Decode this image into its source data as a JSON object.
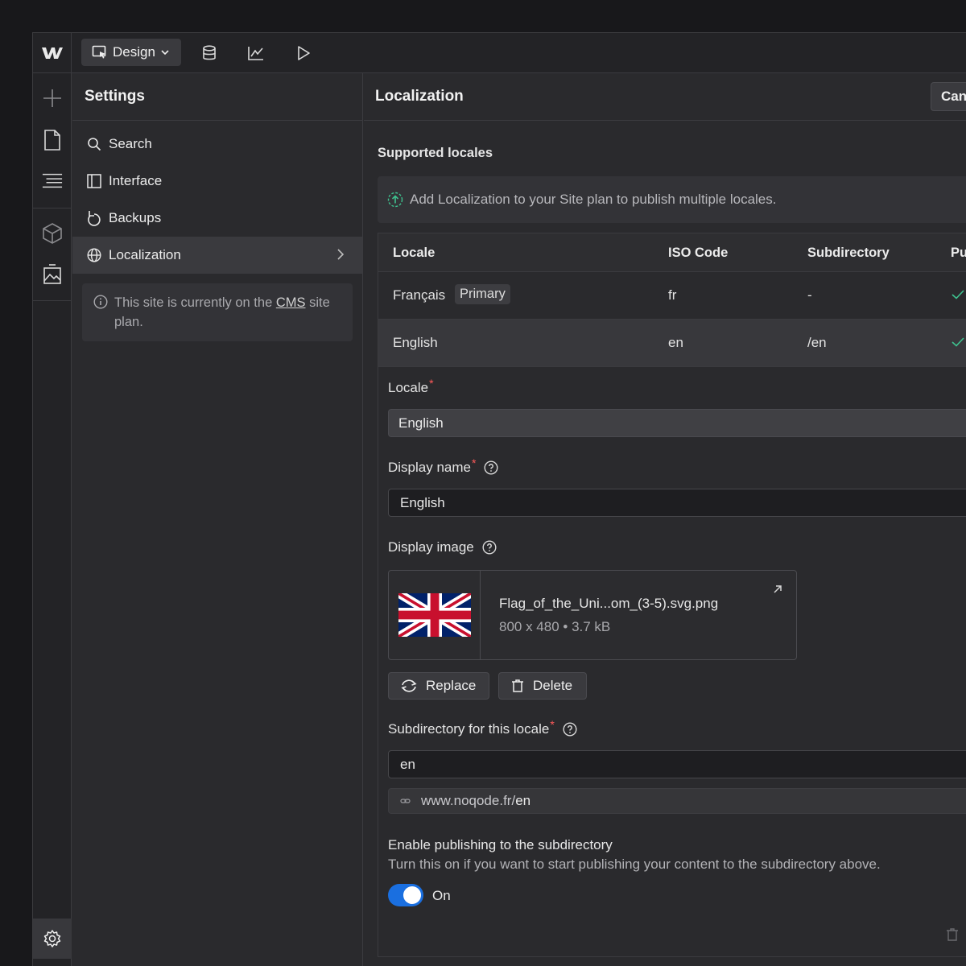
{
  "topbar": {
    "mode_label": "Design",
    "icons": [
      "webflow-logo-icon",
      "design-icon",
      "chevron-down-icon",
      "database-icon",
      "analytics-icon",
      "play-icon"
    ]
  },
  "rail": {
    "icons": [
      "add-icon",
      "page-icon",
      "navigator-icon",
      "components-icon",
      "assets-icon",
      "settings-gear-icon"
    ]
  },
  "settings": {
    "title": "Settings",
    "items": [
      {
        "label": "Search",
        "icon": "search-icon"
      },
      {
        "label": "Interface",
        "icon": "interface-icon"
      },
      {
        "label": "Backups",
        "icon": "backup-icon"
      },
      {
        "label": "Localization",
        "icon": "globe-icon",
        "active": true
      }
    ],
    "info": {
      "prefix": "This site is currently on the ",
      "plan": "CMS",
      "suffix": " site plan."
    }
  },
  "main": {
    "title": "Localization",
    "cancel_label": "Can",
    "section_title": "Supported locales",
    "banner": "Add Localization to your Site plan to publish multiple locales.",
    "table": {
      "headers": [
        "Locale",
        "ISO Code",
        "Subdirectory",
        "Pu"
      ],
      "rows": [
        {
          "locale": "Français",
          "badge": "Primary",
          "iso": "fr",
          "subdir": "-",
          "published": true
        },
        {
          "locale": "English",
          "badge": "",
          "iso": "en",
          "subdir": "/en",
          "published": true
        }
      ]
    },
    "form": {
      "locale_label": "Locale",
      "locale_value": "English",
      "display_name_label": "Display name",
      "display_name_value": "English",
      "display_image_label": "Display image",
      "file_name": "Flag_of_the_Uni...om_(3-5).svg.png",
      "file_meta": "800 x 480 • 3.7 kB",
      "replace_label": "Replace",
      "delete_label": "Delete",
      "subdir_label": "Subdirectory for this locale",
      "subdir_value": "en",
      "url_prefix": "www.noqode.fr/",
      "url_suffix": "en",
      "enable_title": "Enable publishing to the subdirectory",
      "enable_desc": "Turn this on if you want to start publishing your content to the subdirectory above.",
      "toggle_label": "On",
      "toggle_on": true
    }
  },
  "colors": {
    "accent": "#1a6fe0",
    "required": "#ff5a5a",
    "success": "#3ec28f"
  }
}
